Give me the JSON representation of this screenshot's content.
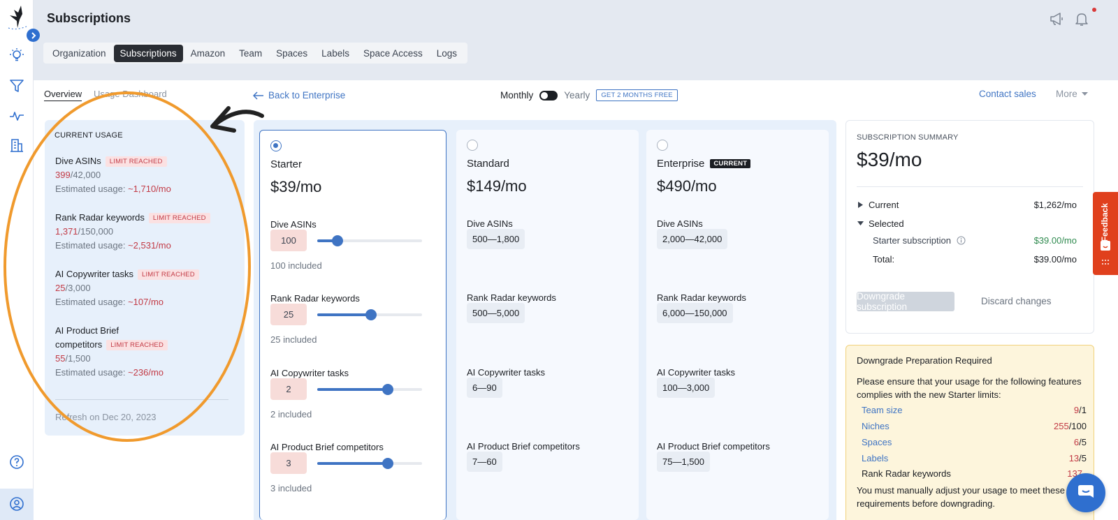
{
  "header": {
    "title": "Subscriptions",
    "tabs": [
      {
        "label": "Organization"
      },
      {
        "label": "Subscriptions"
      },
      {
        "label": "Amazon"
      },
      {
        "label": "Team"
      },
      {
        "label": "Spaces"
      },
      {
        "label": "Labels"
      },
      {
        "label": "Space Access"
      },
      {
        "label": "Logs"
      }
    ],
    "active_tab": "Subscriptions"
  },
  "rail": {
    "icons": [
      "bird-logo-icon",
      "chevron-right-icon",
      "lightbulb-icon",
      "filter-icon",
      "activity-icon",
      "building-icon",
      "help-icon",
      "user-icon"
    ]
  },
  "subnav": {
    "overview": "Overview",
    "usage_dashboard": "Usage Dashboard",
    "back": "Back to Enterprise",
    "monthly": "Monthly",
    "yearly": "Yearly",
    "promo": "GET 2 MONTHS FREE",
    "contact": "Contact sales",
    "more": "More"
  },
  "usage": {
    "heading": "CURRENT USAGE",
    "badge": "LIMIT REACHED",
    "est_prefix": "Estimated usage: ",
    "items": [
      {
        "name": "Dive ASINs",
        "used": "399",
        "limit": "/42,000",
        "estimate": "~1,710/mo"
      },
      {
        "name": "Rank Radar keywords",
        "used": "1,371",
        "limit": "/150,000",
        "estimate": "~2,531/mo"
      },
      {
        "name": "AI Copywriter tasks",
        "used": "25",
        "limit": "/3,000",
        "estimate": "~107/mo"
      },
      {
        "name_line1": "AI Product Brief",
        "name_line2": "competitors",
        "used": "55",
        "limit": "/1,500",
        "estimate": "~236/mo"
      }
    ],
    "refresh": "Refresh on Dec 20, 2023"
  },
  "plans": [
    {
      "name": "Starter",
      "price": "$39/mo",
      "selected": true,
      "features": [
        {
          "label": "Dive ASINs",
          "value": "100",
          "included": "100 included",
          "slider": 0.19
        },
        {
          "label": "Rank Radar keywords",
          "value": "25",
          "included": "25 included",
          "slider": 0.51
        },
        {
          "label": "AI Copywriter tasks",
          "value": "2",
          "included": "2 included",
          "slider": 0.67
        },
        {
          "label": "AI Product Brief competitors",
          "value": "3",
          "included": "3 included",
          "slider": 0.67
        }
      ]
    },
    {
      "name": "Standard",
      "price": "$149/mo",
      "selected": false,
      "features": [
        {
          "label": "Dive ASINs",
          "range": "500—1,800"
        },
        {
          "label": "Rank Radar keywords",
          "range": "500—5,000"
        },
        {
          "label": "AI Copywriter tasks",
          "range": "6—90"
        },
        {
          "label": "AI Product Brief competitors",
          "range": "7—60"
        }
      ]
    },
    {
      "name": "Enterprise",
      "price": "$490/mo",
      "selected": false,
      "badge": "CURRENT",
      "features": [
        {
          "label": "Dive ASINs",
          "range": "2,000—42,000"
        },
        {
          "label": "Rank Radar keywords",
          "range": "6,000—150,000"
        },
        {
          "label": "AI Copywriter tasks",
          "range": "100—3,000"
        },
        {
          "label": "AI Product Brief competitors",
          "range": "75—1,500"
        }
      ]
    }
  ],
  "summary": {
    "heading": "SUBSCRIPTION SUMMARY",
    "price": "$39/mo",
    "current_label": "Current",
    "current_value": "$1,262/mo",
    "selected_label": "Selected",
    "starter_label": "Starter subscription",
    "starter_value": "$39.00/mo",
    "total_label": "Total:",
    "total_value": "$39.00/mo",
    "downgrade_btn": "Downgrade subscription",
    "discard": "Discard changes"
  },
  "prep": {
    "title": "Downgrade Preparation Required",
    "desc": "Please ensure that your usage for the following features complies with the new Starter limits:",
    "rows": [
      {
        "name": "Team size",
        "used": "9",
        "limit": "/1"
      },
      {
        "name": "Niches",
        "used": "255",
        "limit": "/100"
      },
      {
        "name": "Spaces",
        "used": "6",
        "limit": "/5"
      },
      {
        "name": "Labels",
        "used": "13",
        "limit": "/5"
      },
      {
        "name": "Rank Radar keywords",
        "used": "137"
      }
    ],
    "foot": "You must manually adjust your usage to meet these requirements before downgrading."
  },
  "feedback": "Feedback",
  "colors": {
    "accent": "#3f74c3",
    "limit_red": "#c23a45",
    "annotation_orange": "#f09a2d",
    "feedback_orange": "#e0401d"
  }
}
